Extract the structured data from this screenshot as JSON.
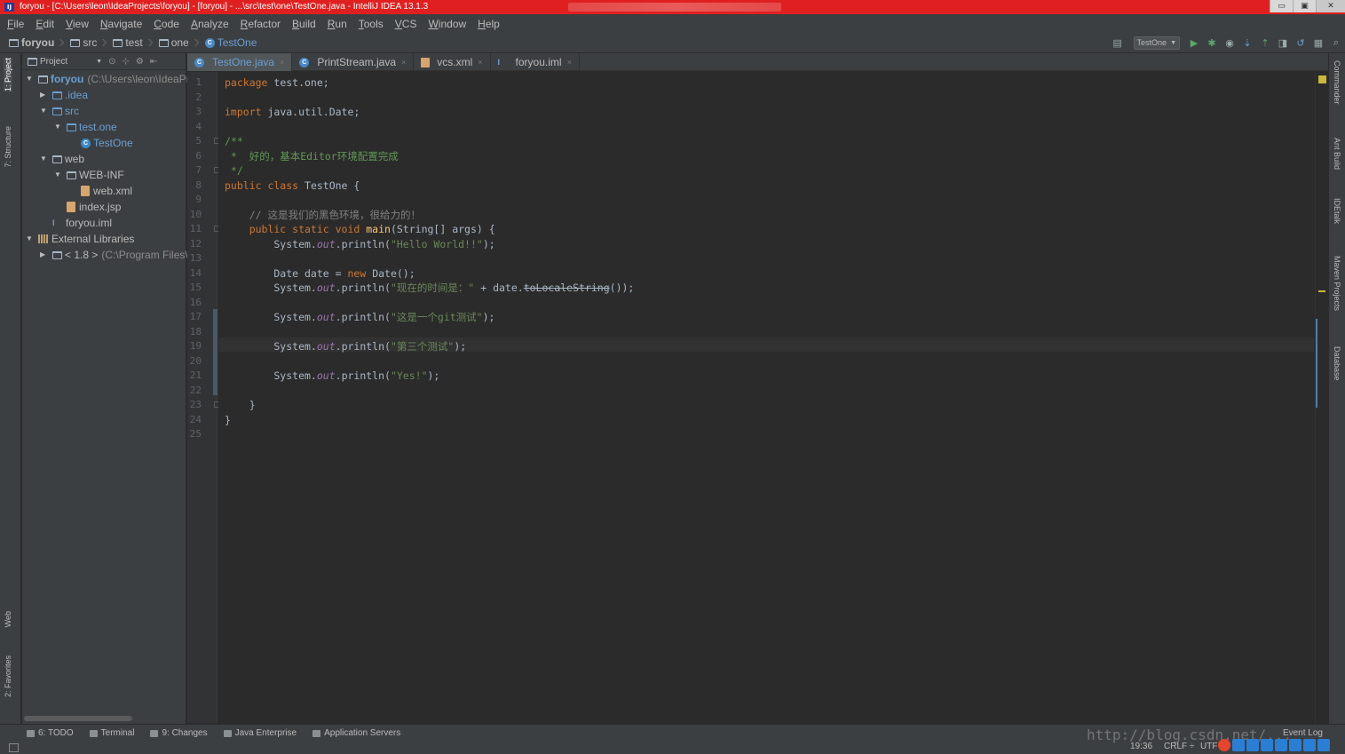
{
  "window": {
    "title": "foryou - [C:\\Users\\leon\\IdeaProjects\\foryou] - [foryou] - ...\\src\\test\\one\\TestOne.java - IntelliJ IDEA 13.1.3",
    "app_icon_text": "IJ",
    "controls": [
      "▭",
      "▣",
      "✕"
    ]
  },
  "menu": [
    "File",
    "Edit",
    "View",
    "Navigate",
    "Code",
    "Analyze",
    "Refactor",
    "Build",
    "Run",
    "Tools",
    "VCS",
    "Window",
    "Help"
  ],
  "breadcrumb": [
    {
      "label": "foryou",
      "kind": "folder"
    },
    {
      "label": "src",
      "kind": "folder"
    },
    {
      "label": "test",
      "kind": "folder"
    },
    {
      "label": "one",
      "kind": "folder"
    },
    {
      "label": "TestOne",
      "kind": "class"
    }
  ],
  "run_config": {
    "label": "TestOne",
    "arrow": "▼"
  },
  "toolbar_icons": [
    "project-structure-icon",
    "run-icon",
    "debug-icon",
    "coverage-icon",
    "vcs-update-icon",
    "vcs-commit-icon",
    "vcs-compare-icon",
    "vcs-revert-icon",
    "sdk-icon",
    "search-everywhere-icon"
  ],
  "left_stripe": {
    "project_tab": "1: Project",
    "structure_tab": "7: Structure",
    "web_tab": "Web",
    "favorites_tab": "2: Favorites"
  },
  "right_stripe": [
    "Commander",
    "Ant Build",
    "IDEtalk",
    "Maven Projects",
    "Database"
  ],
  "project_panel": {
    "header": "Project",
    "tree": [
      {
        "label": "foryou",
        "path": "(C:\\Users\\leon\\IdeaPr",
        "depth": 0,
        "arrow": "▼",
        "icon": "module-icon",
        "bold": true,
        "blue": false
      },
      {
        "label": ".idea",
        "path": "",
        "depth": 1,
        "arrow": "▶",
        "icon": "folder-icon",
        "blue": true
      },
      {
        "label": "src",
        "path": "",
        "depth": 1,
        "arrow": "▼",
        "icon": "folder-icon",
        "blue": true
      },
      {
        "label": "test.one",
        "path": "",
        "depth": 2,
        "arrow": "▼",
        "icon": "package-icon",
        "blue": true
      },
      {
        "label": "TestOne",
        "path": "",
        "depth": 3,
        "arrow": "",
        "icon": "class-icon",
        "blue": true
      },
      {
        "label": "web",
        "path": "",
        "depth": 1,
        "arrow": "▼",
        "icon": "folder-icon",
        "blue": false
      },
      {
        "label": "WEB-INF",
        "path": "",
        "depth": 2,
        "arrow": "▼",
        "icon": "folder-icon",
        "blue": false
      },
      {
        "label": "web.xml",
        "path": "",
        "depth": 3,
        "arrow": "",
        "icon": "xml-icon",
        "blue": false
      },
      {
        "label": "index.jsp",
        "path": "",
        "depth": 2,
        "arrow": "",
        "icon": "jsp-icon",
        "blue": false
      },
      {
        "label": "foryou.iml",
        "path": "",
        "depth": 1,
        "arrow": "",
        "icon": "iml-icon",
        "blue": false
      },
      {
        "label": "External Libraries",
        "path": "",
        "depth": 0,
        "arrow": "▼",
        "icon": "library-icon",
        "blue": false
      },
      {
        "label": "< 1.8 >",
        "path": "(C:\\Program Files\\",
        "depth": 1,
        "arrow": "▶",
        "icon": "jdk-icon",
        "blue": false
      }
    ]
  },
  "editor_tabs": [
    {
      "label": "TestOne.java",
      "icon": "class-icon",
      "active": true
    },
    {
      "label": "PrintStream.java",
      "icon": "class-icon",
      "active": false
    },
    {
      "label": "vcs.xml",
      "icon": "xml-icon",
      "active": false
    },
    {
      "label": "foryou.iml",
      "icon": "iml-icon",
      "active": false
    }
  ],
  "code_lines": [
    [
      [
        "kw",
        "package"
      ],
      [
        "",
        " test.one;"
      ]
    ],
    [],
    [
      [
        "kw",
        "import"
      ],
      [
        "",
        " java.util.Date;"
      ]
    ],
    [],
    [
      [
        "doc",
        "/**"
      ]
    ],
    [
      [
        "doc",
        " *  好的，基本Editor环境配置完成"
      ]
    ],
    [
      [
        "doc",
        " */"
      ]
    ],
    [
      [
        "kw",
        "public class"
      ],
      [
        "",
        " TestOne {"
      ]
    ],
    [],
    [
      [
        "cmt",
        "    // 这是我们的黑色环境，很给力的！"
      ]
    ],
    [
      [
        "kw",
        "    public static void "
      ],
      [
        "fn",
        "main"
      ],
      [
        "",
        "(String[] args) {"
      ]
    ],
    [
      [
        "",
        "        System."
      ],
      [
        "fld",
        "out"
      ],
      [
        "",
        ".println("
      ],
      [
        "str",
        "\"Hello World!!\""
      ],
      [
        "",
        ");"
      ]
    ],
    [],
    [
      [
        "",
        "        Date date = "
      ],
      [
        "kw",
        "new"
      ],
      [
        "",
        " Date();"
      ]
    ],
    [
      [
        "",
        "        System."
      ],
      [
        "fld",
        "out"
      ],
      [
        "",
        ".println("
      ],
      [
        "str",
        "\"现在的时间是：\""
      ],
      [
        "",
        " + date."
      ],
      [
        "dep",
        "toLocaleString"
      ],
      [
        "",
        "());"
      ]
    ],
    [],
    [
      [
        "",
        "        System."
      ],
      [
        "fld",
        "out"
      ],
      [
        "",
        ".println("
      ],
      [
        "str",
        "\"这是一个git测试\""
      ],
      [
        "",
        ");"
      ]
    ],
    [],
    [
      [
        "",
        "        System."
      ],
      [
        "fld",
        "out"
      ],
      [
        "",
        ".println("
      ],
      [
        "str",
        "\"第三个测试\""
      ],
      [
        "",
        ");"
      ]
    ],
    [],
    [
      [
        "",
        "        System."
      ],
      [
        "fld",
        "out"
      ],
      [
        "",
        ".println("
      ],
      [
        "str",
        "\"Yes!\""
      ],
      [
        "",
        ");"
      ]
    ],
    [],
    [
      [
        "",
        "    }"
      ]
    ],
    [
      [
        "",
        "}"
      ]
    ],
    []
  ],
  "bottom_tools": [
    {
      "label": "6: TODO"
    },
    {
      "label": "Terminal"
    },
    {
      "label": "9: Changes"
    },
    {
      "label": "Java Enterprise"
    },
    {
      "label": "Application Servers"
    }
  ],
  "event_log": "Event Log",
  "status": {
    "position": "19:36",
    "line_separator": "CRLF ÷",
    "encoding": "UTF"
  },
  "watermark": "http://blog.csdn.net/..."
}
